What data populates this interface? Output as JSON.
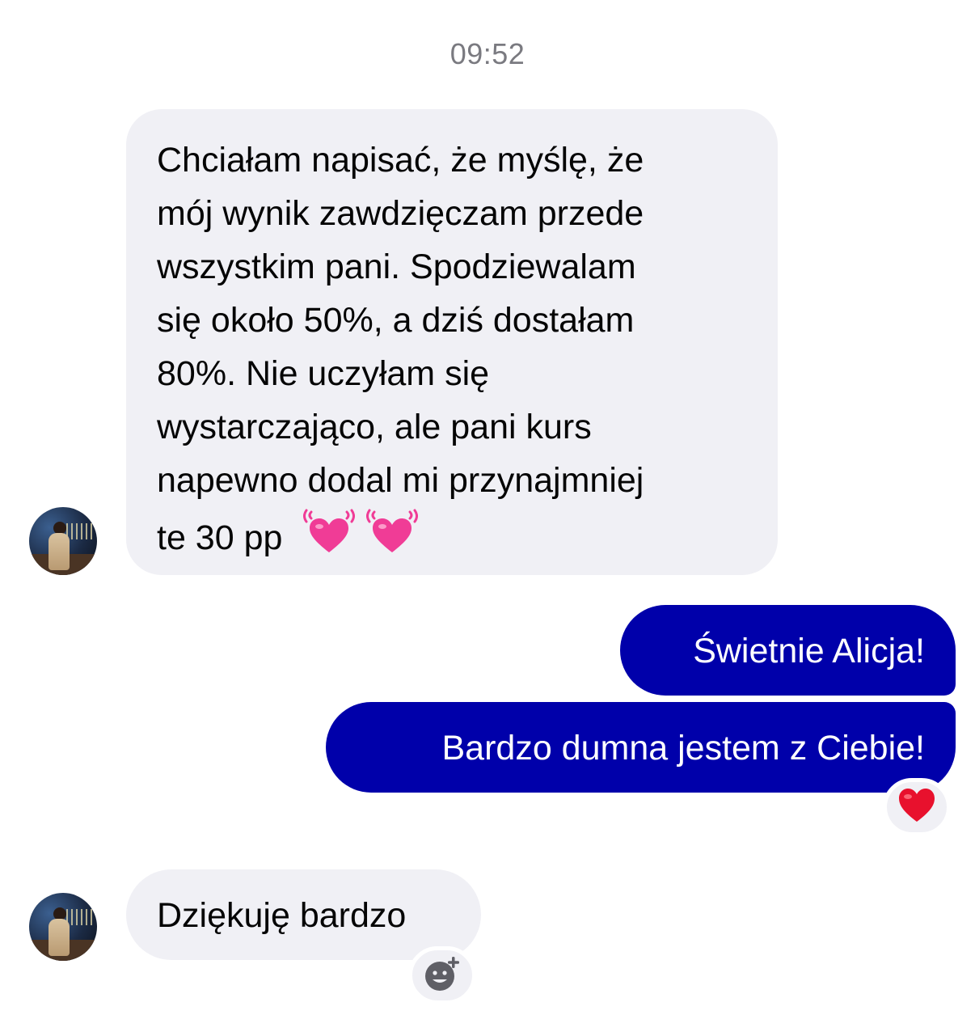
{
  "timestamp": "09:52",
  "messages": [
    {
      "side": "incoming",
      "lines": [
        "Chciałam napisać, że myślę, że",
        "mój wynik zawdzięczam przede",
        "wszystkim pani. Spodziewalam",
        "się około 50%, a dziś dostałam",
        "80%. Nie uczyłam się",
        "wystarczająco, ale pani kurs",
        "napewno dodal mi przynajmniej",
        "te 30 pp"
      ],
      "trailing_emoji": [
        "beating-heart-icon",
        "beating-heart-icon"
      ]
    },
    {
      "side": "outgoing",
      "text": "Świetnie Alicja!"
    },
    {
      "side": "outgoing",
      "text": "Bardzo dumna jestem z Ciebie!",
      "reaction": "red-heart-icon"
    },
    {
      "side": "incoming",
      "text": "Dziękuję bardzo",
      "reaction_button": "add-reaction-icon"
    }
  ],
  "colors": {
    "outgoing_bubble": "#0000aa",
    "incoming_bubble": "#f0f0f5",
    "timestamp": "#7a7a80",
    "heart_pink": "#f03c96",
    "heart_red": "#e8112d"
  }
}
